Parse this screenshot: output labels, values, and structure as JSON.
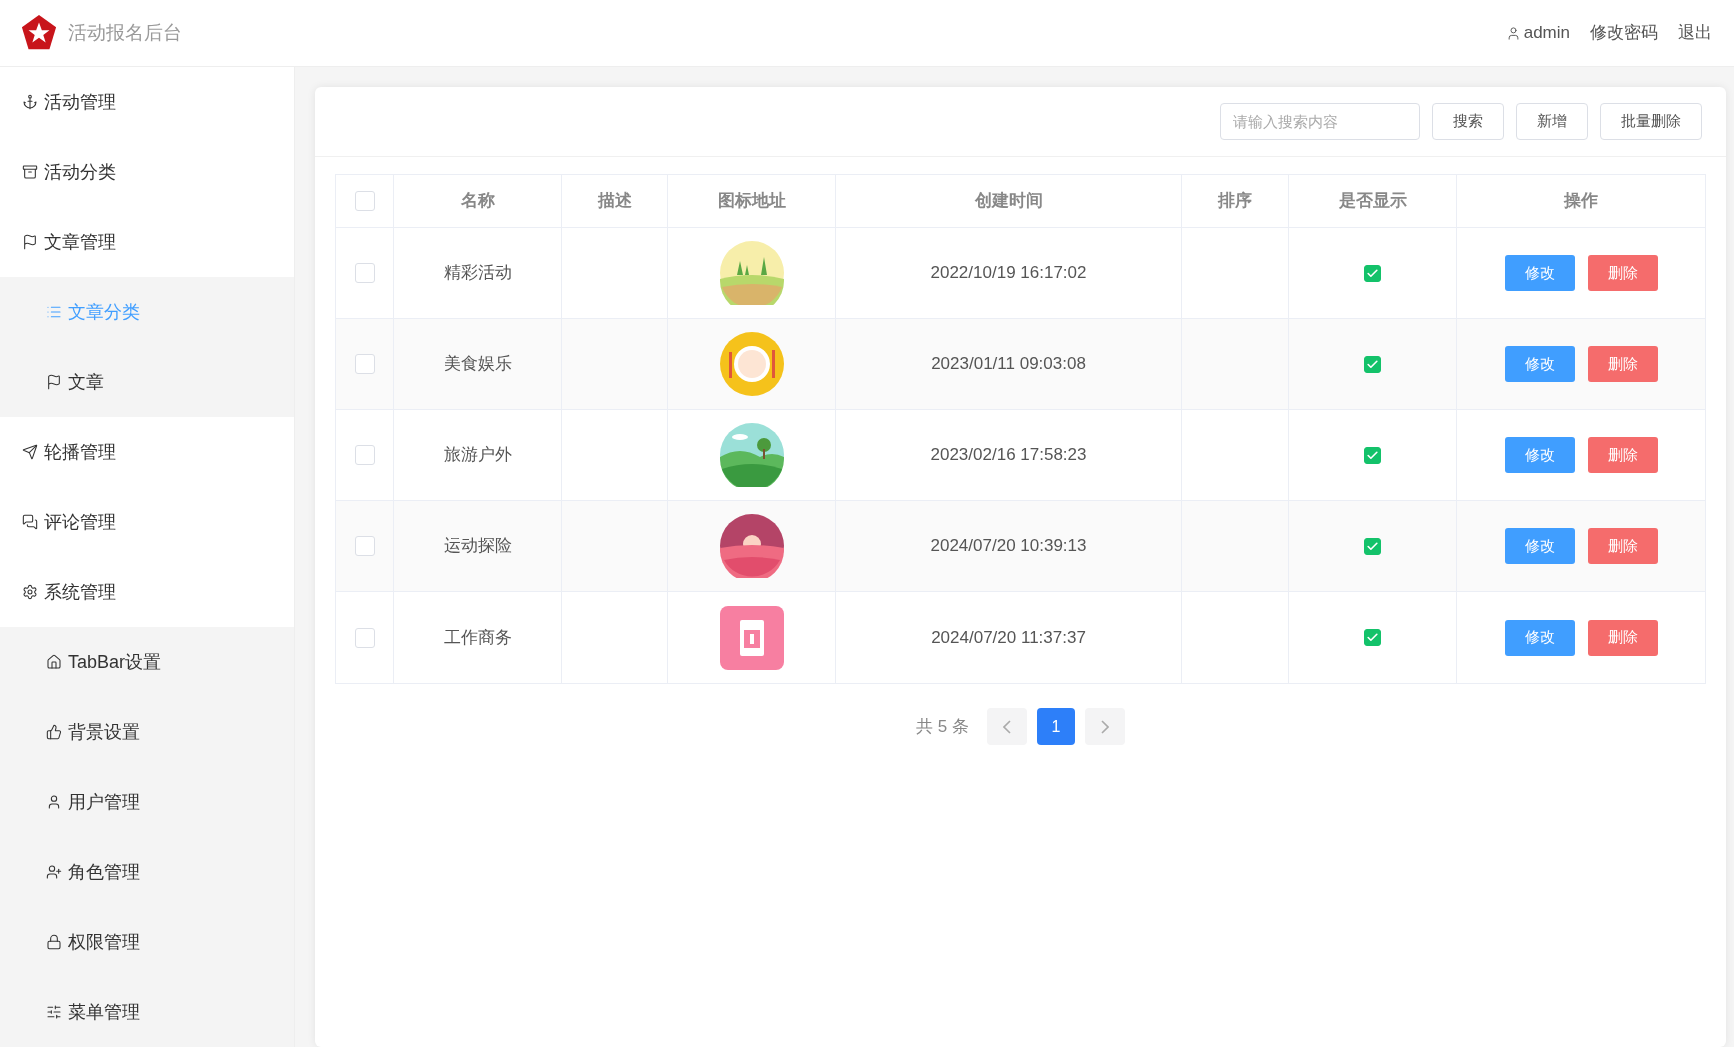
{
  "header": {
    "title": "活动报名后台",
    "user": "admin",
    "links": [
      "修改密码",
      "退出"
    ]
  },
  "sidebar": {
    "items": [
      {
        "label": "活动管理",
        "selected": false
      },
      {
        "label": "活动分类",
        "selected": false
      },
      {
        "label": "文章管理",
        "selected": false,
        "expanded": true,
        "children": [
          {
            "label": "文章分类",
            "selected": true
          },
          {
            "label": "文章",
            "selected": false
          }
        ]
      },
      {
        "label": "轮播管理",
        "selected": false
      },
      {
        "label": "评论管理",
        "selected": false
      },
      {
        "label": "系统管理",
        "selected": false,
        "expanded": true,
        "children": [
          {
            "label": "TabBar设置",
            "selected": false
          },
          {
            "label": "背景设置",
            "selected": false
          },
          {
            "label": "用户管理",
            "selected": false
          },
          {
            "label": "角色管理",
            "selected": false
          },
          {
            "label": "权限管理",
            "selected": false
          },
          {
            "label": "菜单管理",
            "selected": false
          }
        ]
      }
    ]
  },
  "toolbar": {
    "search": {
      "placeholder": "请输入搜索内容"
    },
    "buttons": [
      "搜索",
      "新增",
      "批量删除"
    ]
  },
  "table": {
    "select_all": {
      "checked": false
    },
    "columns": [
      "名称",
      "描述",
      "图标地址",
      "创建时间",
      "排序",
      "是否显示",
      "操作"
    ],
    "rows": [
      {
        "checked": false,
        "name": "精彩活动",
        "created": "2022/10/19 16:17:02",
        "shown": true,
        "actions": [
          "修改",
          "删除"
        ]
      },
      {
        "checked": false,
        "name": "美食娱乐",
        "created": "2023/01/11 09:03:08",
        "shown": true,
        "actions": [
          "修改",
          "删除"
        ]
      },
      {
        "checked": false,
        "name": "旅游户外",
        "created": "2023/02/16 17:58:23",
        "shown": true,
        "actions": [
          "修改",
          "删除"
        ]
      },
      {
        "checked": false,
        "name": "运动探险",
        "created": "2024/07/20 10:39:13",
        "shown": true,
        "actions": [
          "修改",
          "删除"
        ]
      },
      {
        "checked": false,
        "name": "工作商务",
        "created": "2024/07/20 11:37:37",
        "shown": true,
        "actions": [
          "修改",
          "删除"
        ]
      }
    ]
  },
  "pagination": {
    "total": "共 5 条",
    "pages": [
      {
        "label": "1",
        "selected": true
      }
    ]
  }
}
